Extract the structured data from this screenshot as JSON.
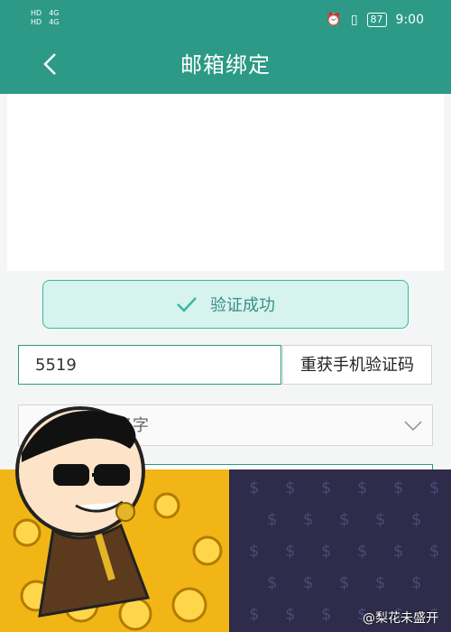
{
  "status_bar": {
    "left": [
      "HD",
      "4G",
      "HD",
      "4G"
    ],
    "battery": "87",
    "time": "9:00"
  },
  "appbar": {
    "title": "邮箱绑定"
  },
  "verify": {
    "success_label": "验证成功",
    "code_value": "5519",
    "resend_label": "重获手机验证码",
    "select_placeholder": "的名字"
  },
  "overlay": {
    "watermark": "@梨花未盛开"
  },
  "colors": {
    "header_green": "#2c9a86",
    "success_bg": "#d6f3ee",
    "success_border": "#3ab6a3"
  }
}
